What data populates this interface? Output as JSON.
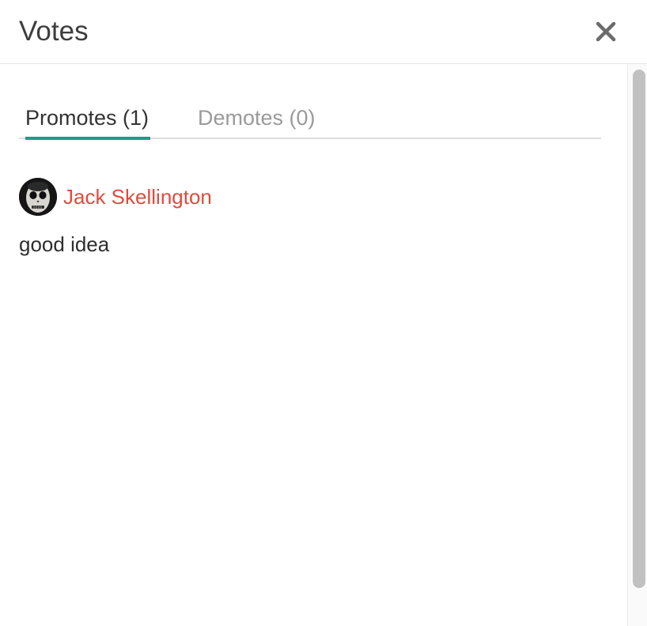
{
  "dialog": {
    "title": "Votes",
    "close_icon": "close-icon"
  },
  "tabs": [
    {
      "label": "Promotes (1)",
      "active": true
    },
    {
      "label": "Demotes (0)",
      "active": false
    }
  ],
  "votes": [
    {
      "user": "Jack Skellington",
      "avatar_icon": "skeleton-face-avatar",
      "comment": "good idea"
    }
  ],
  "colors": {
    "accent": "#1a9e86",
    "username": "#e04b3c",
    "inactive_tab": "#9a9a9a"
  }
}
